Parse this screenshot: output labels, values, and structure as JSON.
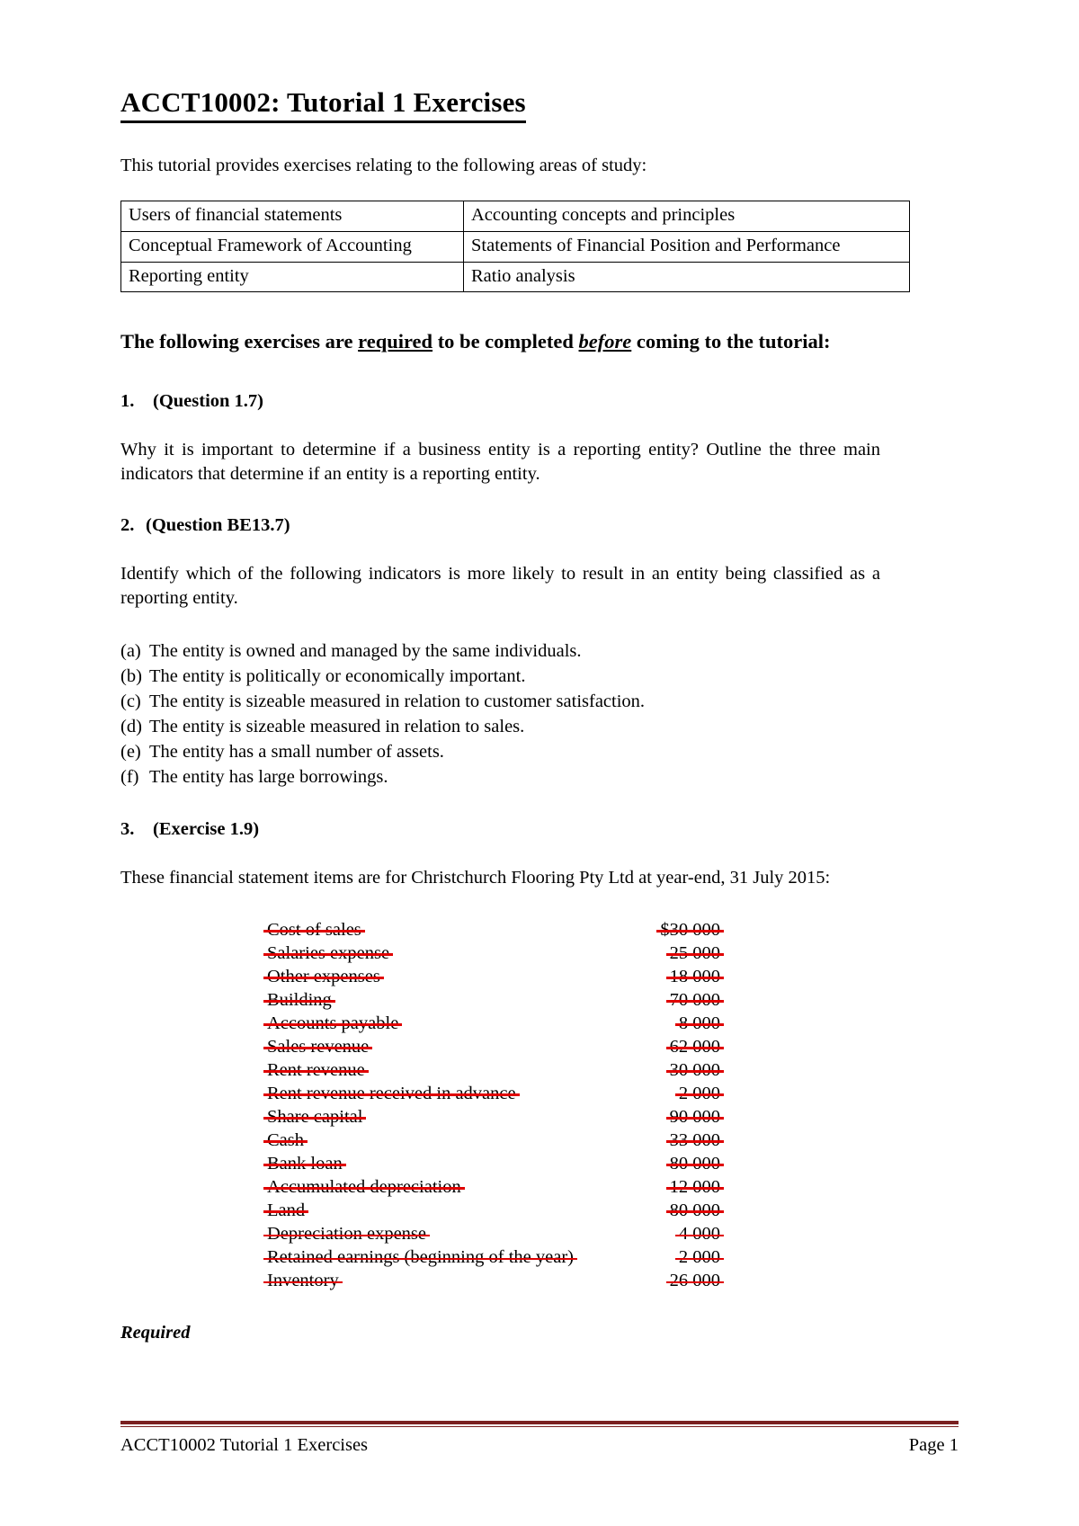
{
  "document": {
    "title": "ACCT10002:  Tutorial 1 Exercises",
    "intro": "This tutorial provides exercises relating to the following areas of study:"
  },
  "topics_table": {
    "rows": [
      {
        "left": "Users of financial statements",
        "right": "Accounting concepts and principles"
      },
      {
        "left": "Conceptual Framework of Accounting",
        "right": "Statements of Financial Position and Performance"
      },
      {
        "left": "Reporting entity",
        "right": "Ratio analysis"
      }
    ]
  },
  "instruction": {
    "part1": "The following exercises are ",
    "required_word": "required",
    "part2": " to be completed ",
    "before_word": "before",
    "part3": " coming to the tutorial:"
  },
  "questions": [
    {
      "number": "1.",
      "title": "(Question 1.7)",
      "body": "Why it is important to determine if a business entity is a reporting entity? Outline the three main indicators that determine if an entity is a reporting entity."
    },
    {
      "number": "2.",
      "title": "(Question BE13.7)",
      "body": "Identify which of the following indicators is more likely to result in an entity being classified as a reporting entity."
    },
    {
      "number": "3.",
      "title": "(Exercise 1.9)",
      "body": "These financial statement items are for Christchurch Flooring Pty Ltd at year-end, 31 July 2015:"
    }
  ],
  "options": [
    {
      "letter": "(a)",
      "text": "The entity is owned and managed by the same individuals."
    },
    {
      "letter": "(b)",
      "text": "The entity is politically or economically important."
    },
    {
      "letter": "(c)",
      "text": "The entity is sizeable measured in relation to customer satisfaction."
    },
    {
      "letter": "(d)",
      "text": "The entity is sizeable measured in relation to sales."
    },
    {
      "letter": "(e)",
      "text": "The entity has a small number of assets."
    },
    {
      "letter": "(f)",
      "text": "The entity has large borrowings."
    }
  ],
  "financial_items": {
    "strikethrough_color": "#e00000",
    "rows": [
      {
        "name": "Cost of sales",
        "amount": "$30 000"
      },
      {
        "name": "Salaries expense",
        "amount": "25 000"
      },
      {
        "name": "Other expenses",
        "amount": "18 000"
      },
      {
        "name": "Building",
        "amount": "70 000"
      },
      {
        "name": "Accounts payable",
        "amount": "8 000"
      },
      {
        "name": "Sales revenue",
        "amount": "62 000"
      },
      {
        "name": "Rent revenue",
        "amount": "30 000"
      },
      {
        "name": "Rent revenue received in advance",
        "amount": "2 000"
      },
      {
        "name": "Share capital",
        "amount": "90 000"
      },
      {
        "name": "Cash",
        "amount": "33 000"
      },
      {
        "name": "Bank loan",
        "amount": "80 000"
      },
      {
        "name": "Accumulated depreciation",
        "amount": "12 000"
      },
      {
        "name": "Land",
        "amount": "80 000"
      },
      {
        "name": "Depreciation expense",
        "amount": "4 000"
      },
      {
        "name": "Retained earnings (beginning of the year)",
        "amount": "2 000"
      },
      {
        "name": "Inventory",
        "amount": "26 000"
      }
    ]
  },
  "required_label": "Required",
  "footer": {
    "left": "ACCT10002 Tutorial 1 Exercises",
    "right": "Page 1",
    "rule_color": "#7a2020"
  }
}
